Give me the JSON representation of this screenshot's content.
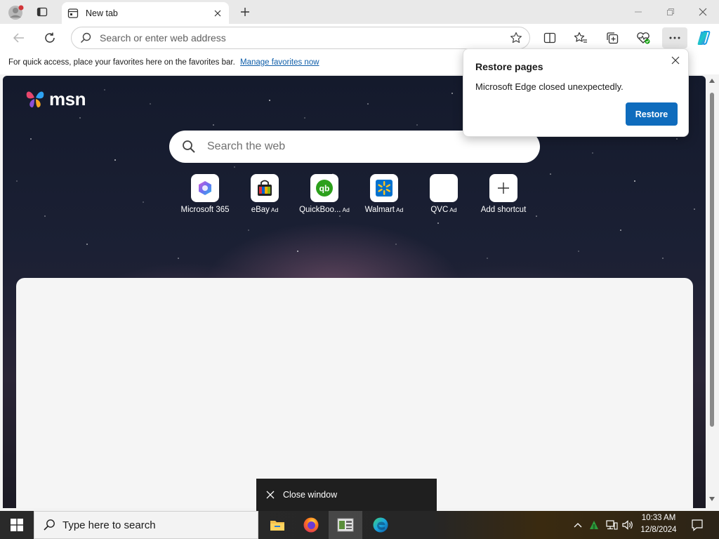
{
  "tab": {
    "title": "New tab"
  },
  "toolbar": {
    "address_placeholder": "Search or enter web address"
  },
  "favorites_bar": {
    "text": "For quick access, place your favorites here on the favorites bar.",
    "link": "Manage favorites now"
  },
  "msn": {
    "logo_text": "msn",
    "search_placeholder": "Search the web",
    "shortcuts": [
      {
        "label": "Microsoft 365",
        "ad": ""
      },
      {
        "label": "eBay",
        "ad": "Ad"
      },
      {
        "label": "QuickBoo...",
        "ad": "Ad"
      },
      {
        "label": "Walmart",
        "ad": "Ad"
      },
      {
        "label": "QVC",
        "ad": "Ad"
      },
      {
        "label": "Add shortcut",
        "ad": ""
      }
    ]
  },
  "restore_popup": {
    "title": "Restore pages",
    "message": "Microsoft Edge closed unexpectedly.",
    "button": "Restore"
  },
  "close_window_tooltip": {
    "label": "Close window"
  },
  "taskbar": {
    "search_placeholder": "Type here to search",
    "time": "10:33 AM",
    "date": "12/8/2024"
  },
  "colors": {
    "accent": "#0f6cbd",
    "link": "#0f5ea9",
    "taskbar": "#262626"
  }
}
